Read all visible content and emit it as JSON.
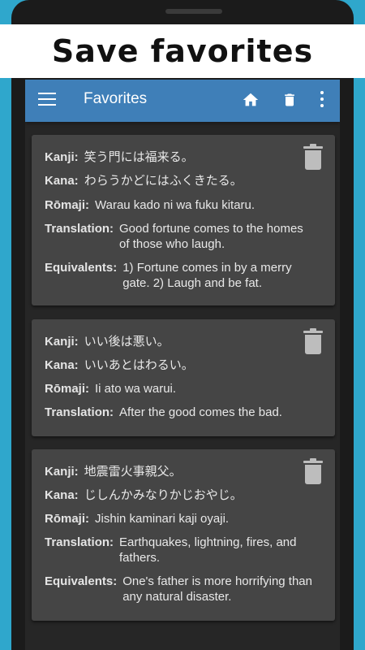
{
  "banner": {
    "title": "Save favorites"
  },
  "app_bar": {
    "title": "Favorites",
    "icons": [
      "menu-icon",
      "home-icon",
      "trash-icon",
      "more-vert-icon"
    ]
  },
  "colors": {
    "app_bar": "#3f7fb8",
    "background": "#2fa7cc",
    "card": "#454545",
    "screen": "#262626"
  },
  "labels": {
    "kanji": "Kanji:",
    "kana": "Kana:",
    "romaji": "Rōmaji:",
    "translation": "Translation:",
    "equivalents": "Equivalents:"
  },
  "cards": [
    {
      "kanji": "笑う門には福来る。",
      "kana": "わらうかどにはふくきたる。",
      "romaji": "Warau kado ni wa fuku kitaru.",
      "translation_1": "Good fortune comes to the homes",
      "translation_2": "of those who laugh.",
      "equivalents_1": "1) Fortune comes in by a merry",
      "equivalents_2": "gate. 2) Laugh and be fat."
    },
    {
      "kanji": "いい後は悪い。",
      "kana": "いいあとはわるい。",
      "romaji": "Ii ato wa warui.",
      "translation_1": "After the good comes the bad."
    },
    {
      "kanji": "地震雷火事親父。",
      "kana": "じしんかみなりかじおやじ。",
      "romaji": "Jishin kaminari kaji oyaji.",
      "translation_1": "Earthquakes, lightning, fires, and",
      "translation_2": "fathers.",
      "equivalents_1": "One's father is more horrifying than",
      "equivalents_2": "any natural disaster."
    }
  ]
}
